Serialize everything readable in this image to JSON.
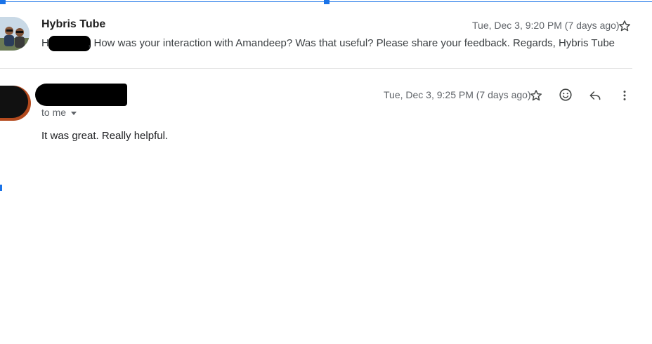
{
  "thread": {
    "messages": [
      {
        "sender": "Hybris Tube",
        "date": "Tue, Dec 3, 9:20 PM (7 days ago)",
        "snippet_greeting": "Hi",
        "snippet_text": ", How was your interaction with Amandeep? Was that useful? Please share your feedback. Regards, Hybris Tube",
        "starred": false
      },
      {
        "date": "Tue, Dec 3, 9:25 PM (7 days ago)",
        "recipient": "to me",
        "body": "It was great. Really helpful.",
        "starred": false
      }
    ]
  },
  "icons": {
    "star": "star-icon",
    "emoji": "emoji-icon",
    "reply": "reply-icon",
    "more": "more-vert-icon",
    "caret": "chevron-down-icon"
  },
  "colors": {
    "selection": "#1a73e8",
    "muted_text": "#5f6368",
    "redaction": "#000000"
  }
}
